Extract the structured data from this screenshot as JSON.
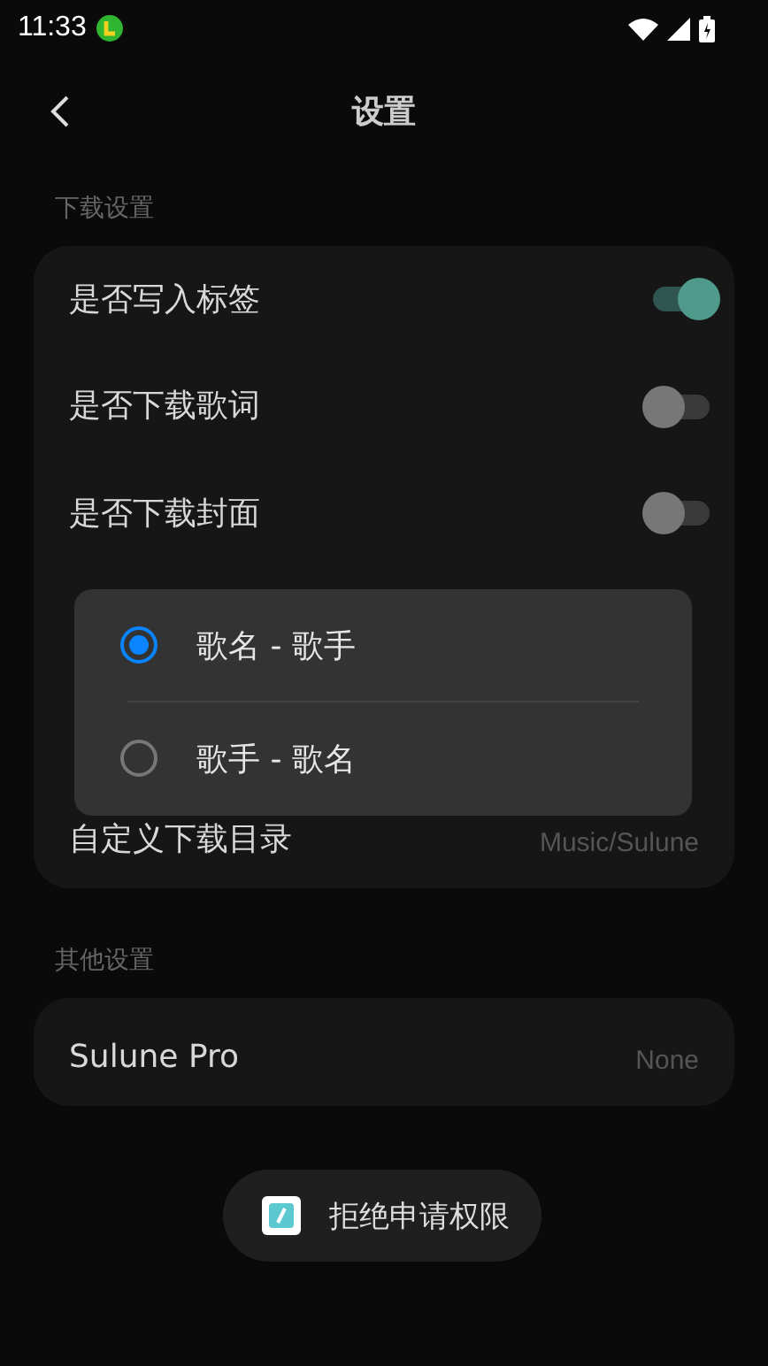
{
  "status_bar": {
    "time": "11:33"
  },
  "header": {
    "title": "设置"
  },
  "sections": [
    {
      "title": "下载设置",
      "rows": [
        {
          "kind": "toggle",
          "label": "是否写入标签",
          "on": true
        },
        {
          "kind": "toggle",
          "label": "是否下载歌词",
          "on": false
        },
        {
          "kind": "toggle",
          "label": "是否下载封面",
          "on": false
        },
        {
          "kind": "hidden"
        },
        {
          "kind": "hidden"
        },
        {
          "kind": "value",
          "label": "自定义下载目录",
          "value": "Music/Sulune"
        }
      ]
    },
    {
      "title": "其他设置",
      "rows": [
        {
          "kind": "value",
          "label": "Sulune Pro",
          "value": "None"
        }
      ]
    }
  ],
  "dialog": {
    "options": [
      {
        "label": "歌名 - 歌手",
        "selected": true
      },
      {
        "label": "歌手 - 歌名",
        "selected": false
      }
    ]
  },
  "toast": {
    "text": "拒绝申请权限"
  }
}
